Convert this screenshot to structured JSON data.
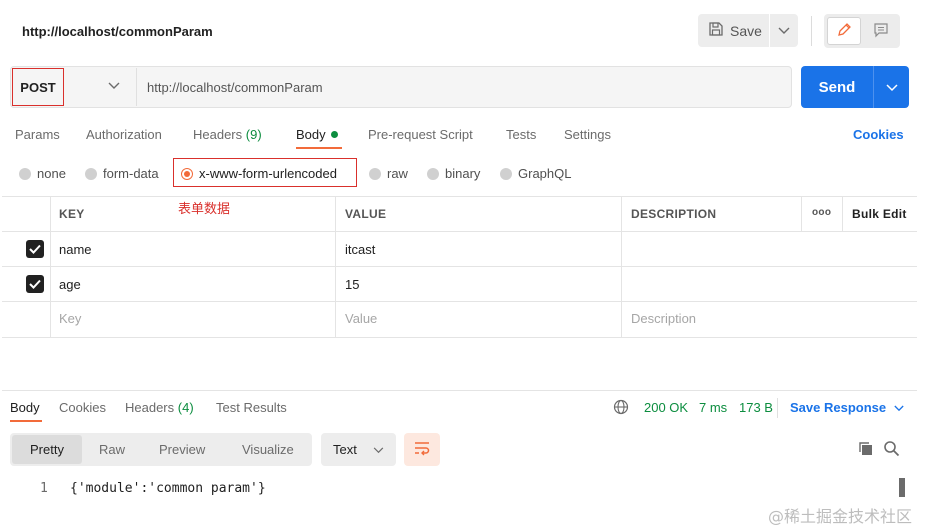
{
  "header": {
    "request_title": "http://localhost/commonParam",
    "save_label": "Save"
  },
  "request": {
    "method": "POST",
    "url": "http://localhost/commonParam",
    "send_label": "Send"
  },
  "tabs": {
    "params": "Params",
    "authorization": "Authorization",
    "headers": "Headers",
    "headers_count": "(9)",
    "body": "Body",
    "prerequest": "Pre-request Script",
    "tests": "Tests",
    "settings": "Settings",
    "cookies": "Cookies"
  },
  "body_types": {
    "none": "none",
    "form_data": "form-data",
    "urlencoded": "x-www-form-urlencoded",
    "raw": "raw",
    "binary": "binary",
    "graphql": "GraphQL"
  },
  "annotation": "表单数据",
  "table": {
    "col_key": "KEY",
    "col_value": "VALUE",
    "col_desc": "DESCRIPTION",
    "more": "ooo",
    "bulk_edit": "Bulk Edit",
    "rows": [
      {
        "key": "name",
        "value": "itcast",
        "checked": true
      },
      {
        "key": "age",
        "value": "15",
        "checked": true
      }
    ],
    "placeholder": {
      "key": "Key",
      "value": "Value",
      "desc": "Description"
    }
  },
  "response": {
    "tabs": {
      "body": "Body",
      "cookies": "Cookies",
      "headers": "Headers",
      "headers_count": "(4)",
      "test_results": "Test Results"
    },
    "status": "200 OK",
    "time": "7 ms",
    "size": "173 B",
    "save_response": "Save Response",
    "formats": {
      "pretty": "Pretty",
      "raw": "Raw",
      "preview": "Preview",
      "visualize": "Visualize"
    },
    "language": "Text",
    "code_line_number": "1",
    "code_line": "{'module':'common param'}"
  },
  "watermark": "@稀土掘金技术社区",
  "colors": {
    "accent": "#f26b3a",
    "primary": "#1a73e8",
    "success": "#0c8d3f",
    "highlight_border": "#d9302c"
  }
}
